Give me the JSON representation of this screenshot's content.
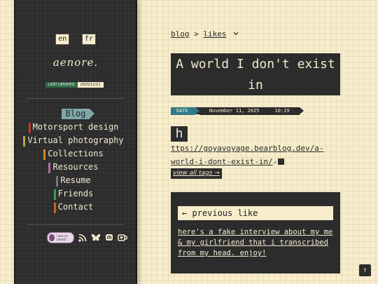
{
  "sidebar": {
    "languages": [
      "en",
      "fr"
    ],
    "logo": "aenore.",
    "last_updated_label": "LAST UPDATED",
    "last_updated_value": "2025/11/11",
    "nav": [
      {
        "label": "Blog",
        "color": "#7fa7aa",
        "active": true
      },
      {
        "label": "Motorsport design",
        "color": "#c0392b"
      },
      {
        "label": "Virtual photography",
        "color": "#b5a642"
      },
      {
        "label": "Collections",
        "color": "#d08a2a"
      },
      {
        "label": "Resources",
        "color": "#b56aa0"
      },
      {
        "label": "Resume",
        "color": "#777777"
      },
      {
        "label": "Friends",
        "color": "#3f9a55"
      },
      {
        "label": "Contact",
        "color": "#d0601e"
      }
    ],
    "badge_text": "i was on cohost!",
    "social_icons": [
      "rss-icon",
      "bluesky-icon",
      "mastodon-icon",
      "kofi-icon"
    ]
  },
  "breadcrumb": {
    "root": "blog",
    "separator": ">",
    "current": "likes"
  },
  "post": {
    "title": "A world I don't exist in",
    "date_label": "DATE",
    "date": "November 11, 2025",
    "time": "10:19",
    "dropcap": "h",
    "link_text": "ttps://goyavoyage.bearblog.dev/a-world-i-dont-exist-in/",
    "external_icon": "↗",
    "view_tags": "view all tags →"
  },
  "previous": {
    "label": "← previous like",
    "text": "here's a fake interview about my me & my girlfriend that i transcribed from my head. enjoy!"
  },
  "back_to_top": "↑"
}
